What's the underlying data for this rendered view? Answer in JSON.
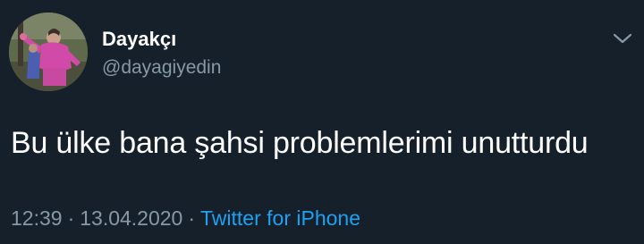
{
  "tweet": {
    "display_name": "Dayakçı",
    "handle": "@dayagiyedin",
    "text": "Bu ülke bana şahsi problemlerimi unutturdu",
    "time": "12:39",
    "date": "13.04.2020",
    "separator": "·",
    "source": "Twitter for iPhone",
    "menu_icon": "chevron-down-icon",
    "avatar_icon": "profile-photo"
  },
  "colors": {
    "background": "#15202b",
    "primary_text": "#ffffff",
    "secondary_text": "#8899a6",
    "link": "#1da1f2"
  }
}
